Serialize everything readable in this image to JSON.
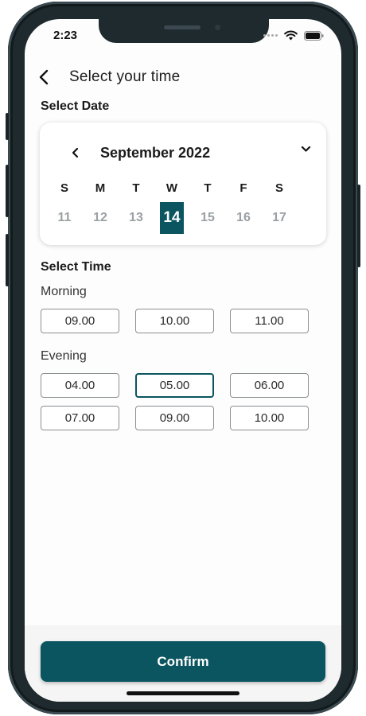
{
  "status_bar": {
    "time": "2:23"
  },
  "header": {
    "title": "Select your time"
  },
  "date_section": {
    "label": "Select Date"
  },
  "calendar": {
    "month_label": "September 2022",
    "weekdays": [
      "S",
      "M",
      "T",
      "W",
      "T",
      "F",
      "S"
    ],
    "days": [
      "11",
      "12",
      "13",
      "14",
      "15",
      "16",
      "17"
    ],
    "selected_day": "14"
  },
  "time_section": {
    "label": "Select Time",
    "morning": {
      "label": "Morning",
      "slots": [
        "09.00",
        "10.00",
        "11.00"
      ]
    },
    "evening": {
      "label": "Evening",
      "slots": [
        "04.00",
        "05.00",
        "06.00",
        "07.00",
        "09.00",
        "10.00"
      ]
    },
    "selected_slot": "05.00"
  },
  "footer": {
    "confirm_label": "Confirm"
  },
  "colors": {
    "accent": "#0b5560",
    "frame": "#1e2a2e",
    "background": "#fdfdfd"
  }
}
